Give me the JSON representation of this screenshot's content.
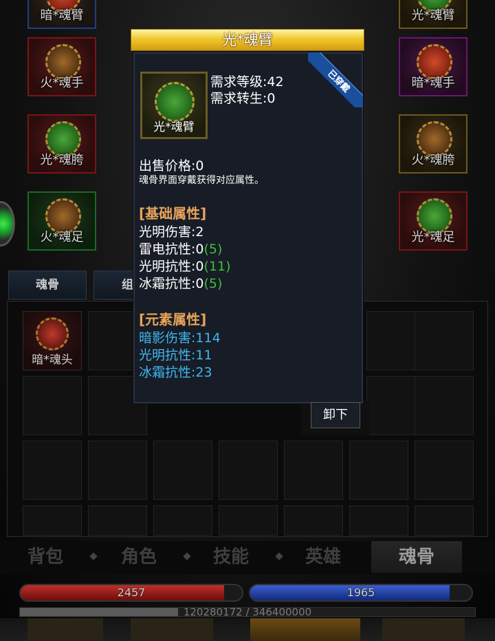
{
  "slots_left": [
    {
      "label": "暗*魂臂",
      "color": "blue"
    },
    {
      "label": "火*魂手",
      "color": "red"
    },
    {
      "label": "光*魂胯",
      "color": "red"
    },
    {
      "label": "火*魂足",
      "color": "green"
    }
  ],
  "slots_right": [
    {
      "label": "光*魂臂",
      "color": "gold"
    },
    {
      "label": "暗*魂手",
      "color": "purple"
    },
    {
      "label": "火*魂胯",
      "color": "gold"
    },
    {
      "label": "光*魂足",
      "color": "red"
    }
  ],
  "tabs": [
    "魂骨",
    "组"
  ],
  "bag": {
    "first_item_label": "暗*魂头"
  },
  "nav": [
    "背包",
    "角色",
    "技能",
    "英雄",
    "魂骨"
  ],
  "nav_active": "魂骨",
  "hp": {
    "value": "2457",
    "fill": 0.92
  },
  "mp": {
    "value": "1965",
    "fill": 0.9
  },
  "exp": {
    "text": "120280172 / 346400000",
    "fill": 0.347
  },
  "popup": {
    "title": "光*魂臂",
    "item_label": "光*魂臂",
    "ribbon": "已穿戴",
    "req_level": "需求等级:42",
    "req_rebirth": "需求转生:0",
    "price": "出售价格:0",
    "desc": "魂骨界面穿戴获得对应属性。",
    "base_header": "[基础属性]",
    "base": [
      {
        "text": "光明伤害:2",
        "bonus": ""
      },
      {
        "text": "雷电抗性:0",
        "bonus": "(5)"
      },
      {
        "text": "光明抗性:0",
        "bonus": "(11)"
      },
      {
        "text": "冰霜抗性:0",
        "bonus": "(5)"
      }
    ],
    "elem_header": "[元素属性]",
    "elem": [
      "暗影伤害:114",
      "光明抗性:11",
      "冰霜抗性:23"
    ],
    "unequip": "卸下"
  },
  "colors": {
    "accent_gold": "#f0c82a",
    "stat_cyan": "#3fb8f0",
    "bonus_green": "#3fbf3a",
    "header_orange": "#e8a45a"
  }
}
